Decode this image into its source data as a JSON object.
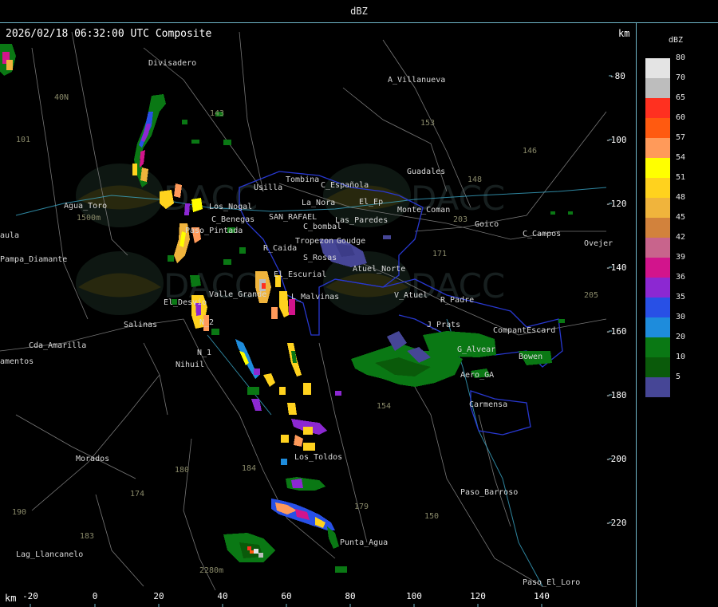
{
  "header": {
    "title": "dBZ"
  },
  "subtitle": "2026/02/18 06:32:00 UTC Composite",
  "axis_unit_top": "km",
  "axis_unit_bottom": "km",
  "x_ticks": [
    "-20",
    "0",
    "20",
    "40",
    "60",
    "80",
    "100",
    "120",
    "140"
  ],
  "y_ticks": [
    "-80",
    "-100",
    "-120",
    "-140",
    "-160",
    "-180",
    "-200",
    "-220"
  ],
  "legend": {
    "unit": "dBZ",
    "entries": [
      {
        "label": "80",
        "color": "#e4e4e4"
      },
      {
        "label": "70",
        "color": "#bdbdbd"
      },
      {
        "label": "65",
        "color": "#ff3020"
      },
      {
        "label": "60",
        "color": "#ff5a10"
      },
      {
        "label": "57",
        "color": "#ff9a5a"
      },
      {
        "label": "54",
        "color": "#ffff00"
      },
      {
        "label": "51",
        "color": "#ffd21e"
      },
      {
        "label": "48",
        "color": "#f0b43c"
      },
      {
        "label": "45",
        "color": "#d2823c"
      },
      {
        "label": "42",
        "color": "#c8648c"
      },
      {
        "label": "39",
        "color": "#d2148c"
      },
      {
        "label": "36",
        "color": "#8c28d2"
      },
      {
        "label": "35",
        "color": "#2850e6"
      },
      {
        "label": "30",
        "color": "#1e8cdc"
      },
      {
        "label": "20",
        "color": "#0a7814"
      },
      {
        "label": "10",
        "color": "#0a5a0a"
      },
      {
        "label": "5",
        "color": "#464696"
      }
    ]
  },
  "places": [
    "Divisadero",
    "A_Villanueva",
    "Guadales",
    "Tombina",
    "Usilla",
    "C_Española",
    "La_Nora",
    "El_Ep",
    "Agua_Toro",
    "Los_Nogal",
    "C_Benegas",
    "SAN_RAFAEL",
    "Las_Paredes",
    "C_bombal",
    "Monte_Coman",
    "Goico",
    "C_Campos",
    "Ovejer",
    "Pampa_Diamante",
    "aula",
    "Paso_Pintada",
    "R_Caida",
    "Tropezon",
    "Goudge",
    "S_Rosas",
    "Atuel_Norte",
    "El_Escurial",
    "Valle_Grande",
    "L_Malvinas",
    "El_Desvio",
    "Salinas",
    "N_2",
    "V_Atuel",
    "R_Padre",
    "J_Prats",
    "CompantEscard",
    "Cda_Amarilla",
    "amentos",
    "N_1",
    "Nihuil",
    "G_Alvear",
    "Bowen",
    "Aero_GA",
    "Carmensa",
    "Los_Toldos",
    "Morados",
    "Paso_Barroso",
    "Punta_Agua",
    "Lag_Llancanelo",
    "Paso_El_Loro",
    "40N",
    "101",
    "153",
    "146",
    "148",
    "203",
    "171",
    "205",
    "1500m",
    "2280m",
    "143",
    "184",
    "180",
    "179",
    "183",
    "150",
    "190",
    "174",
    "154"
  ],
  "watermarks": [
    "DACC",
    "Dirección de Agricultura y Contingencias Climáticas"
  ]
}
